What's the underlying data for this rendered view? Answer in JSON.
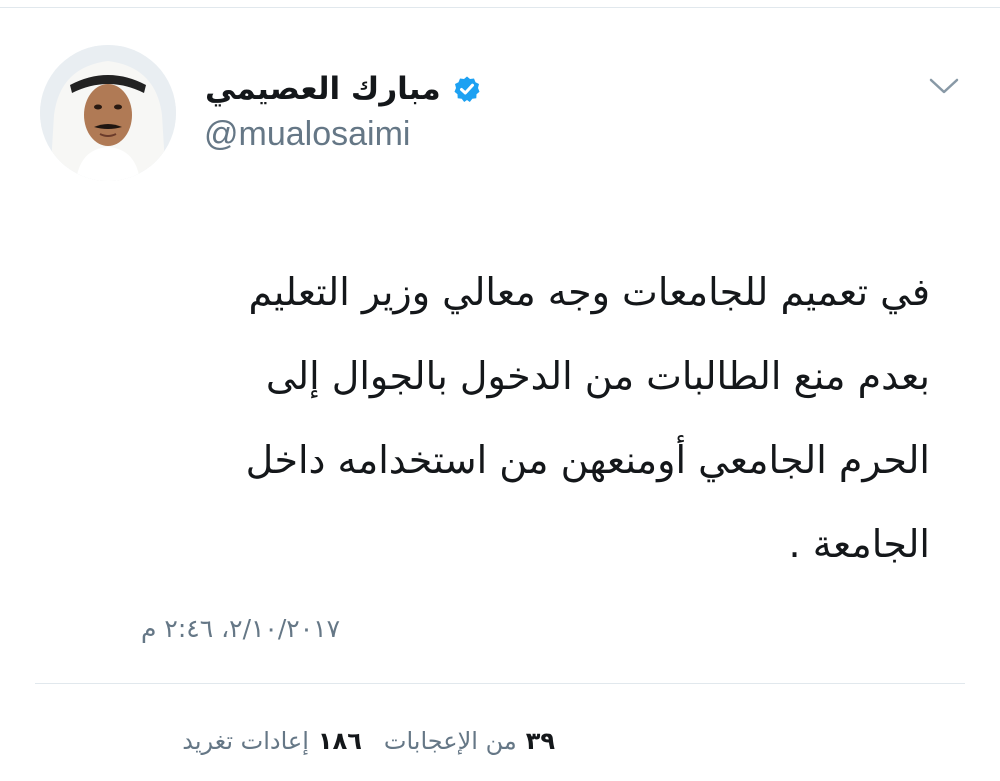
{
  "tweet": {
    "display_name": "مبارك العصيمي",
    "handle": "@mualosaimi",
    "verified_icon": "verified-badge-icon",
    "caret_icon": "chevron-down-icon",
    "text_lines": [
      "في تعميم للجامعات وجه معالي وزير التعليم",
      "بعدم منع الطالبات من الدخول بالجوال إلى",
      "الحرم الجامعي أومنعهن من استخدامه داخل",
      "الجامعة ."
    ],
    "timestamp": "٢/١٠/٢٠١٧، ٢:٤٦ م"
  },
  "stats": {
    "retweets_count": "١٨٦",
    "retweets_label": "إعادات تغريد",
    "likes_count": "٣٩",
    "likes_label": "من الإعجابات"
  },
  "colors": {
    "text_primary": "#14171a",
    "text_secondary": "#657786",
    "verified_blue": "#1da1f2",
    "divider": "#e1e8ed"
  }
}
